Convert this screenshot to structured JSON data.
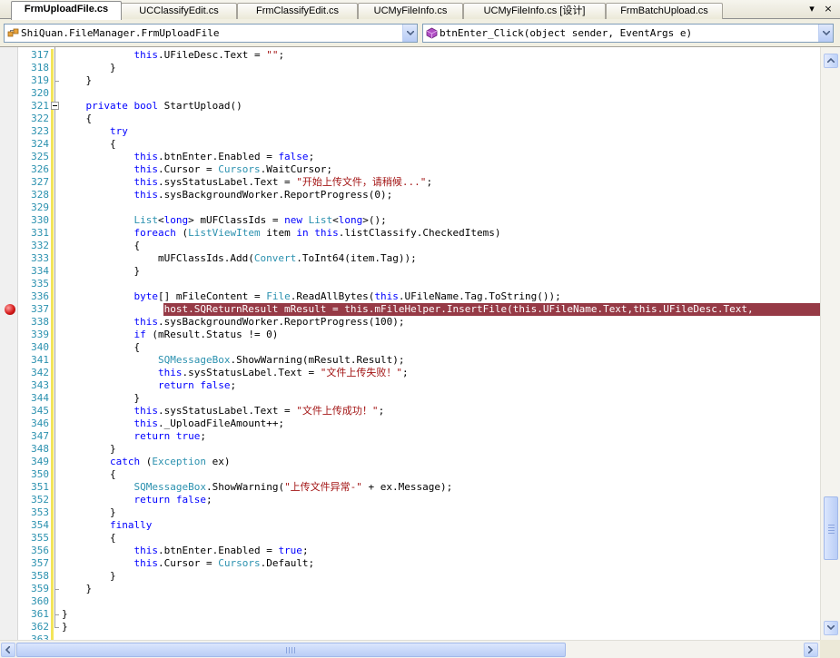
{
  "tabs": [
    {
      "label": "FrmUploadFile.cs",
      "active": true
    },
    {
      "label": "UCClassifyEdit.cs",
      "active": false
    },
    {
      "label": "FrmClassifyEdit.cs",
      "active": false
    },
    {
      "label": "UCMyFileInfo.cs",
      "active": false
    },
    {
      "label": "UCMyFileInfo.cs [设计]",
      "active": false
    },
    {
      "label": "FrmBatchUpload.cs",
      "active": false
    }
  ],
  "tab_controls": {
    "dropdown": "▾",
    "close": "×"
  },
  "nav": {
    "type_combo": {
      "value": "ShiQuan.FileManager.FrmUploadFile",
      "icon": "class-icon"
    },
    "member_combo": {
      "value": "btnEnter_Click(object sender, EventArgs e)",
      "icon": "method-icon"
    }
  },
  "colors": {
    "keyword": "#0000ff",
    "type": "#2b91af",
    "string": "#a31515",
    "line_number": "#2b91af",
    "breakpoint_highlight": "#963a46"
  },
  "breakpoint_line": 337,
  "code_lines": [
    {
      "n": "317",
      "t": "            this.UFileDesc.Text = \"\";"
    },
    {
      "n": "318",
      "t": "        }"
    },
    {
      "n": "319",
      "t": "    }"
    },
    {
      "n": "320",
      "t": ""
    },
    {
      "n": "321",
      "t": "    private bool StartUpload()"
    },
    {
      "n": "322",
      "t": "    {"
    },
    {
      "n": "323",
      "t": "        try"
    },
    {
      "n": "324",
      "t": "        {"
    },
    {
      "n": "325",
      "t": "            this.btnEnter.Enabled = false;"
    },
    {
      "n": "326",
      "t": "            this.Cursor = Cursors.WaitCursor;"
    },
    {
      "n": "327",
      "t": "            this.sysStatusLabel.Text = \"开始上传文件，请稍候...\";"
    },
    {
      "n": "328",
      "t": "            this.sysBackgroundWorker.ReportProgress(0);"
    },
    {
      "n": "329",
      "t": ""
    },
    {
      "n": "330",
      "t": "            List<long> mUFClassIds = new List<long>();"
    },
    {
      "n": "331",
      "t": "            foreach (ListViewItem item in this.listClassify.CheckedItems)"
    },
    {
      "n": "332",
      "t": "            {"
    },
    {
      "n": "333",
      "t": "                mUFClassIds.Add(Convert.ToInt64(item.Tag));"
    },
    {
      "n": "334",
      "t": "            }"
    },
    {
      "n": "335",
      "t": ""
    },
    {
      "n": "336",
      "t": "            byte[] mFileContent = File.ReadAllBytes(this.UFileName.Tag.ToString());"
    },
    {
      "n": "337",
      "t": "            localhost.SQReturnResult mResult = this.mFileHelper.InsertFile(this.UFileName.Text,this.UFileDesc.Text,"
    },
    {
      "n": "338",
      "t": "            this.sysBackgroundWorker.ReportProgress(100);"
    },
    {
      "n": "339",
      "t": "            if (mResult.Status != 0)"
    },
    {
      "n": "340",
      "t": "            {"
    },
    {
      "n": "341",
      "t": "                SQMessageBox.ShowWarning(mResult.Result);"
    },
    {
      "n": "342",
      "t": "                this.sysStatusLabel.Text = \"文件上传失败！\";"
    },
    {
      "n": "343",
      "t": "                return false;"
    },
    {
      "n": "344",
      "t": "            }"
    },
    {
      "n": "345",
      "t": "            this.sysStatusLabel.Text = \"文件上传成功！\";"
    },
    {
      "n": "346",
      "t": "            this._UploadFileAmount++;"
    },
    {
      "n": "347",
      "t": "            return true;"
    },
    {
      "n": "348",
      "t": "        }"
    },
    {
      "n": "349",
      "t": "        catch (Exception ex)"
    },
    {
      "n": "350",
      "t": "        {"
    },
    {
      "n": "351",
      "t": "            SQMessageBox.ShowWarning(\"上传文件异常-\" + ex.Message);"
    },
    {
      "n": "352",
      "t": "            return false;"
    },
    {
      "n": "353",
      "t": "        }"
    },
    {
      "n": "354",
      "t": "        finally"
    },
    {
      "n": "355",
      "t": "        {"
    },
    {
      "n": "356",
      "t": "            this.btnEnter.Enabled = true;"
    },
    {
      "n": "357",
      "t": "            this.Cursor = Cursors.Default;"
    },
    {
      "n": "358",
      "t": "        }"
    },
    {
      "n": "359",
      "t": "    }"
    },
    {
      "n": "360",
      "t": ""
    },
    {
      "n": "361",
      "t": "}"
    },
    {
      "n": "362",
      "t": "}"
    },
    {
      "n": "363",
      "t": ""
    }
  ]
}
